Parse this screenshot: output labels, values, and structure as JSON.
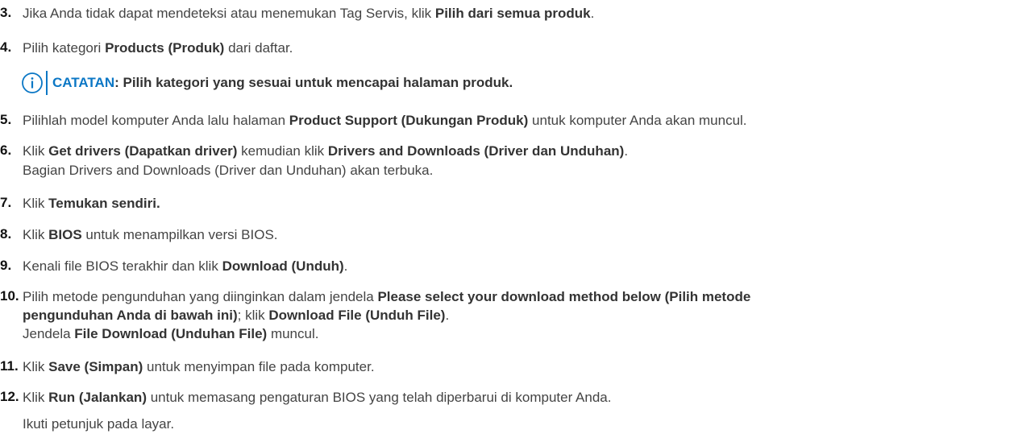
{
  "steps": [
    {
      "num": "3.",
      "parts": [
        "Jika Anda tidak dapat mendeteksi atau menemukan Tag Servis, klik ",
        "Pilih dari semua produk",
        "."
      ]
    },
    {
      "num": "4.",
      "parts": [
        "Pilih kategori ",
        "Products (Produk)",
        " dari daftar."
      ]
    },
    {
      "num": "5.",
      "parts": [
        "Pilihlah model komputer Anda lalu halaman ",
        "Product Support (Dukungan Produk)",
        " untuk komputer Anda akan muncul."
      ]
    },
    {
      "num": "6.",
      "parts": [
        "Klik ",
        "Get drivers (Dapatkan driver)",
        " kemudian klik ",
        "Drivers and Downloads (Driver dan Unduhan)",
        "."
      ],
      "sub": "Bagian Drivers and Downloads (Driver dan Unduhan) akan terbuka."
    },
    {
      "num": "7.",
      "parts": [
        "Klik ",
        "Temukan sendiri."
      ]
    },
    {
      "num": "8.",
      "parts": [
        "Klik ",
        "BIOS",
        " untuk menampilkan versi BIOS."
      ]
    },
    {
      "num": "9.",
      "parts": [
        "Kenali file BIOS terakhir dan klik ",
        "Download (Unduh)",
        "."
      ]
    },
    {
      "num": "10.",
      "parts": [
        "Pilih metode pengunduhan yang diinginkan dalam jendela ",
        "Please select your download method below (Pilih metode"
      ],
      "line2": [
        "",
        "pengunduhan Anda di bawah ini)",
        "; klik ",
        "Download File (Unduh File)",
        "."
      ],
      "line3": [
        "Jendela ",
        "File Download (Unduhan File)",
        " muncul."
      ]
    },
    {
      "num": "11.",
      "parts": [
        "Klik ",
        "Save (Simpan)",
        " untuk menyimpan file pada komputer."
      ]
    },
    {
      "num": "12.",
      "parts": [
        "Klik ",
        "Run (Jalankan)",
        " untuk memasang pengaturan BIOS yang telah diperbarui di komputer Anda."
      ]
    }
  ],
  "note": {
    "label": "CATATAN",
    "text": ": Pilih kategori yang sesuai untuk mencapai halaman produk."
  },
  "final_text": "Ikuti petunjuk pada layar.",
  "colors": {
    "accent": "#0b77c5",
    "text": "#444444",
    "bold": "#333333"
  }
}
